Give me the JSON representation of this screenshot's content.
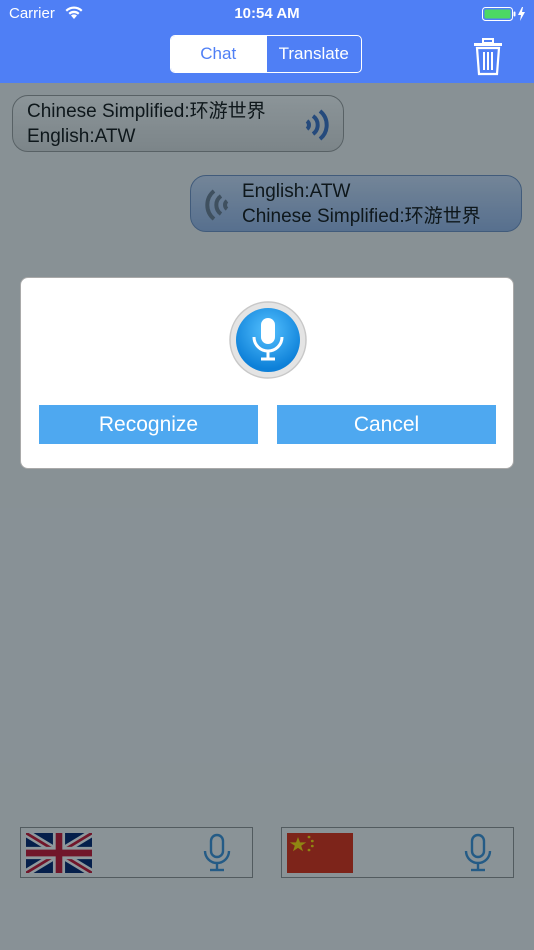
{
  "status_bar": {
    "carrier": "Carrier",
    "time": "10:54 AM"
  },
  "header": {
    "tabs": [
      {
        "label": "Chat",
        "active": true
      },
      {
        "label": "Translate",
        "active": false
      }
    ],
    "trash_icon": "trash-icon"
  },
  "messages": [
    {
      "side": "left",
      "line1": "Chinese Simplified:环游世界",
      "line2": "English:ATW",
      "icon": "speaker-icon"
    },
    {
      "side": "right",
      "line1": "English:ATW",
      "line2": "Chinese Simplified:环游世界",
      "icon": "speaker-icon"
    }
  ],
  "dialog": {
    "icon": "microphone-icon",
    "recognize_label": "Recognize",
    "cancel_label": "Cancel"
  },
  "language_bars": [
    {
      "flag": "uk-flag-icon",
      "mic": "microphone-icon"
    },
    {
      "flag": "china-flag-icon",
      "mic": "microphone-icon"
    }
  ],
  "colors": {
    "header_blue": "#4f7ff5",
    "button_blue": "#4ea8f0",
    "mic_blue": "#1a90e0"
  }
}
